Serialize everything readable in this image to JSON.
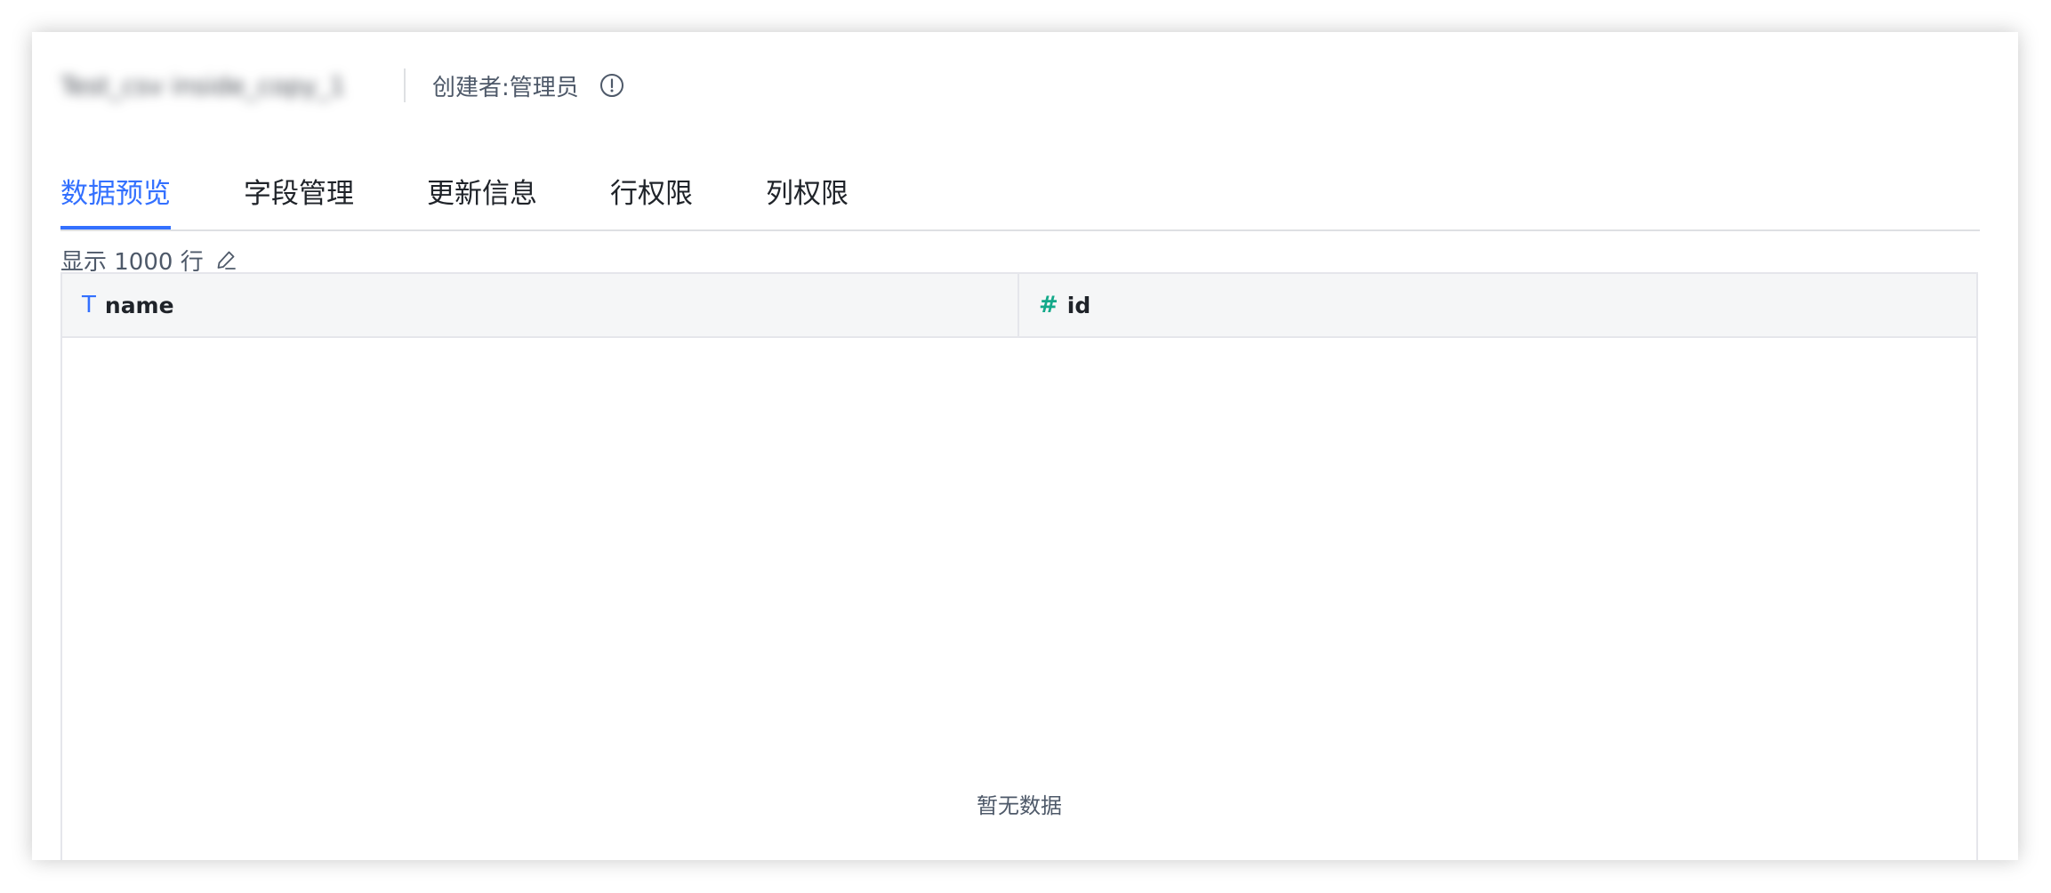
{
  "header": {
    "table_name": "Test_csv inside_copy_1",
    "creator": "创建者:管理员",
    "info_icon": "info-circle-icon"
  },
  "tabs": [
    {
      "label": "数据预览",
      "active": true
    },
    {
      "label": "字段管理",
      "active": false
    },
    {
      "label": "更新信息",
      "active": false
    },
    {
      "label": "行权限",
      "active": false
    },
    {
      "label": "列权限",
      "active": false
    }
  ],
  "preview": {
    "row_count_label": "显示 1000 行",
    "edit_icon": "pencil-icon"
  },
  "table": {
    "columns": [
      {
        "type_icon": "T",
        "type": "text",
        "label": "name"
      },
      {
        "type_icon": "#",
        "type": "number",
        "label": "id"
      }
    ],
    "rows": [],
    "empty_text": "暂无数据"
  },
  "colors": {
    "accent": "#3370ff",
    "number_type": "#14a98a",
    "border": "#e5e6eb",
    "header_bg": "#f5f6f7"
  }
}
